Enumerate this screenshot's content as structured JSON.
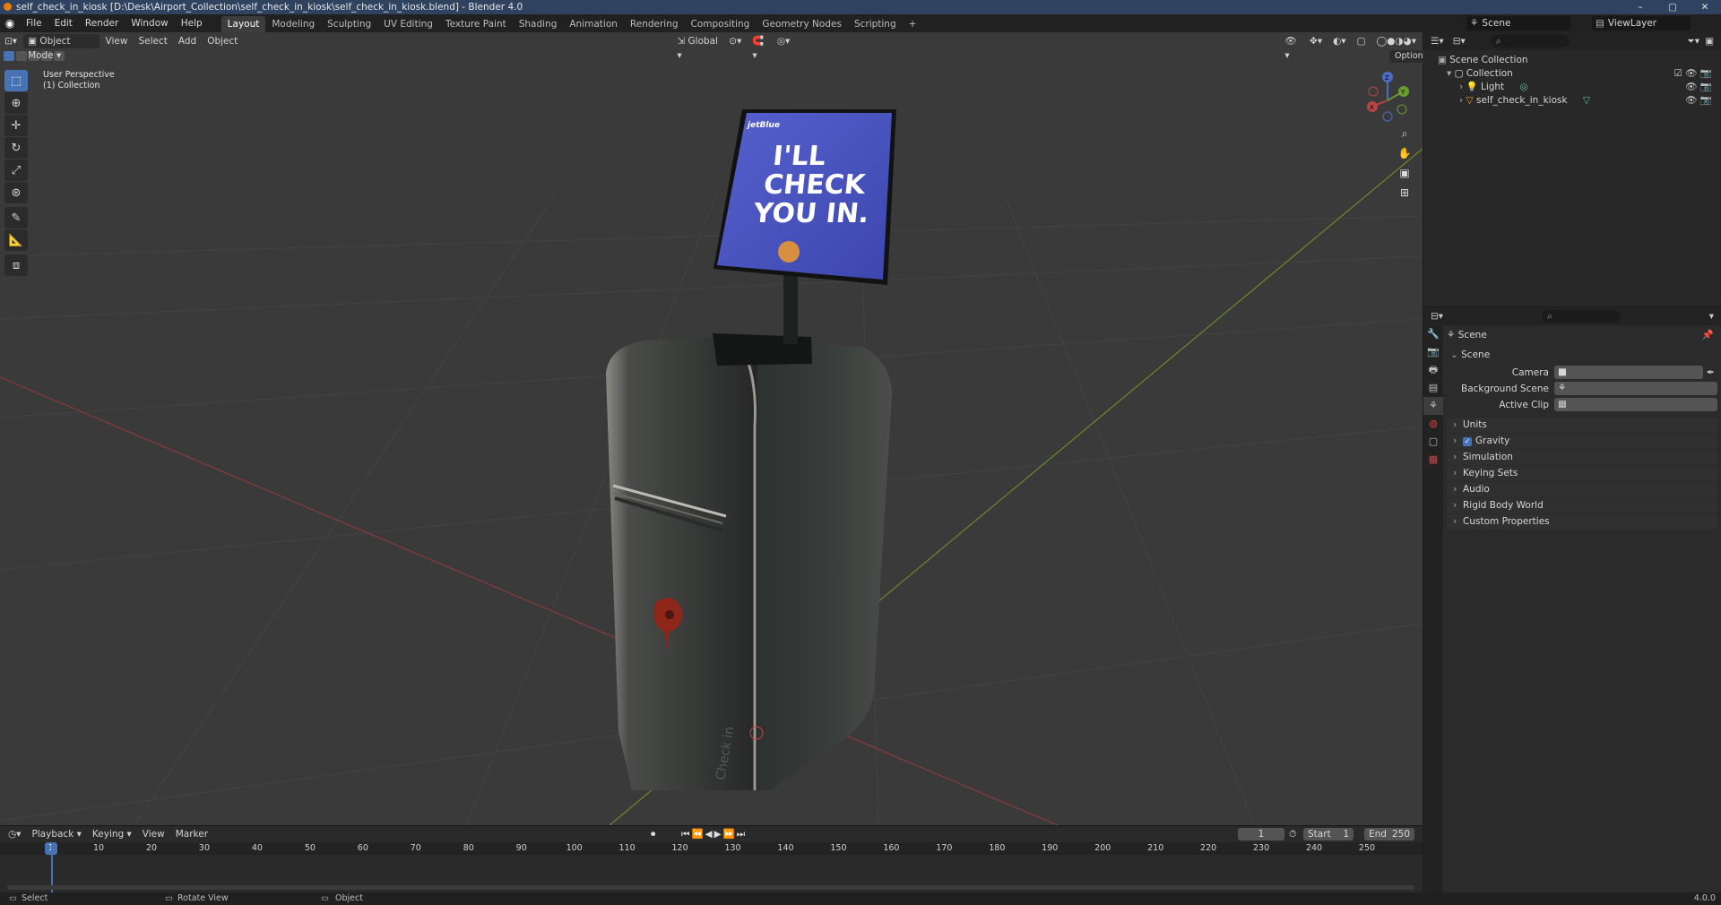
{
  "titlebar": {
    "title": "self_check_in_kiosk [D:\\Desk\\Airport_Collection\\self_check_in_kiosk\\self_check_in_kiosk.blend] - Blender 4.0",
    "minimize": "–",
    "maximize": "▢",
    "close": "✕"
  },
  "menu": {
    "items": [
      "File",
      "Edit",
      "Render",
      "Window",
      "Help"
    ],
    "workspaces": [
      "Layout",
      "Modeling",
      "Sculpting",
      "UV Editing",
      "Texture Paint",
      "Shading",
      "Animation",
      "Rendering",
      "Compositing",
      "Geometry Nodes",
      "Scripting"
    ],
    "add_workspace": "+",
    "scene_name": "Scene",
    "viewlayer_name": "ViewLayer"
  },
  "viewport_header": {
    "mode": "Object Mode",
    "menus": [
      "View",
      "Select",
      "Add",
      "Object"
    ],
    "transform_orientation": "Global",
    "options": "Options"
  },
  "viewport": {
    "perspective_label": "User Perspective",
    "collection_label": "(1) Collection",
    "screen_brand": "jetBlue",
    "screen_text_1": "I'LL",
    "screen_text_2": "CHECK",
    "screen_text_3": "YOU IN.",
    "kiosk_side_text": "Check in"
  },
  "gizmo": {
    "x": "X",
    "y": "Y",
    "z": "Z"
  },
  "timeline": {
    "menus": [
      "Playback",
      "Keying",
      "View",
      "Marker"
    ],
    "current_frame": "1",
    "start_label": "Start",
    "start_value": "1",
    "end_label": "End",
    "end_value": "250",
    "ruler_marks": [
      "1",
      "10",
      "20",
      "30",
      "40",
      "50",
      "60",
      "70",
      "80",
      "90",
      "100",
      "110",
      "120",
      "130",
      "140",
      "150",
      "160",
      "170",
      "180",
      "190",
      "200",
      "210",
      "220",
      "230",
      "240",
      "250"
    ]
  },
  "status": {
    "select": "Select",
    "rotate": "Rotate View",
    "object": "Object",
    "version": "4.0.0"
  },
  "outliner": {
    "scene_collection": "Scene Collection",
    "collection": "Collection",
    "items": [
      "Light",
      "self_check_in_kiosk"
    ]
  },
  "properties": {
    "breadcrumb": "Scene",
    "section": "Scene",
    "fields": [
      {
        "label": "Camera",
        "value": ""
      },
      {
        "label": "Background Scene",
        "value": ""
      },
      {
        "label": "Active Clip",
        "value": ""
      }
    ],
    "panels": [
      "Units",
      "Gravity",
      "Simulation",
      "Keying Sets",
      "Audio",
      "Rigid Body World",
      "Custom Properties"
    ],
    "gravity_checked": true
  },
  "colors": {
    "accent": "#4772b3",
    "titlebar": "#2f4260",
    "viewport_bg": "#3a3a3a",
    "axis_x": "#9a3c3c",
    "axis_y": "#6f8a2d",
    "screen_blue": "#4a55c4",
    "playhead": "#4772b3"
  }
}
